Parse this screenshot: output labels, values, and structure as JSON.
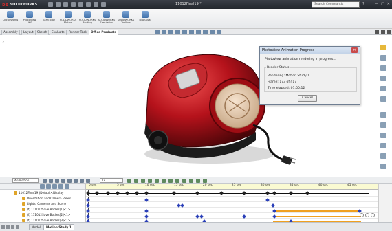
{
  "titlebar": {
    "app_name": "SOLIDWORKS",
    "doc_title": "11012Final19 *",
    "search_placeholder": "Search Commands",
    "help": "?",
    "controls": [
      "—",
      "□",
      "✕"
    ]
  },
  "ribbon": {
    "buttons": [
      "CircuitWorks",
      "PhotoView 360",
      "ScanTo3D",
      "SOLIDWORKS Motion",
      "SOLIDWORKS Routing",
      "SOLIDWORKS Simulation",
      "SOLIDWORKS Toolbox",
      "TolAnalyst"
    ]
  },
  "tabs": [
    {
      "label": "Assembly",
      "active": false
    },
    {
      "label": "Layout",
      "active": false
    },
    {
      "label": "Sketch",
      "active": false
    },
    {
      "label": "Evaluate",
      "active": false
    },
    {
      "label": "Render Tools",
      "active": false
    },
    {
      "label": "Office Products",
      "active": true
    }
  ],
  "dialog": {
    "title": "PhotoView Animation Progress",
    "line1": "PhotoView animation rendering in progress...",
    "render_status": "Render Status",
    "rendering": "Rendering: Motion Study 1",
    "frame": "Frame: 173 of 417",
    "time_elapsed": "Time elapsed: 01:00:12",
    "cancel_label": "Cancel"
  },
  "motion": {
    "study_type": "Animation",
    "speed": "1x",
    "tree_rows": [
      "11012Final19 (Default<Display",
      "Orientation and Camera Views",
      "Lights, Cameras and Scene",
      "(f) 111012Save Bodies[1]<1>",
      "(f) 111012Save Bodies[2]<1>",
      "(f) 111012Save Bodies[3]<1>"
    ],
    "time_labels": [
      "0 sec",
      "5 sec",
      "10 sec",
      "15 sec",
      "20 sec",
      "25 sec",
      "30 sec",
      "35 sec",
      "40 sec",
      "45 sec"
    ]
  },
  "bottom_tabs": [
    {
      "label": "Model",
      "active": false
    },
    {
      "label": "Motion Study 1",
      "active": true
    }
  ],
  "colors": {
    "model_red": "#b5121b",
    "key_blue": "#2a3fb8",
    "bar_orange": "#f0a020",
    "ruler_yellow": "#fafad2"
  }
}
